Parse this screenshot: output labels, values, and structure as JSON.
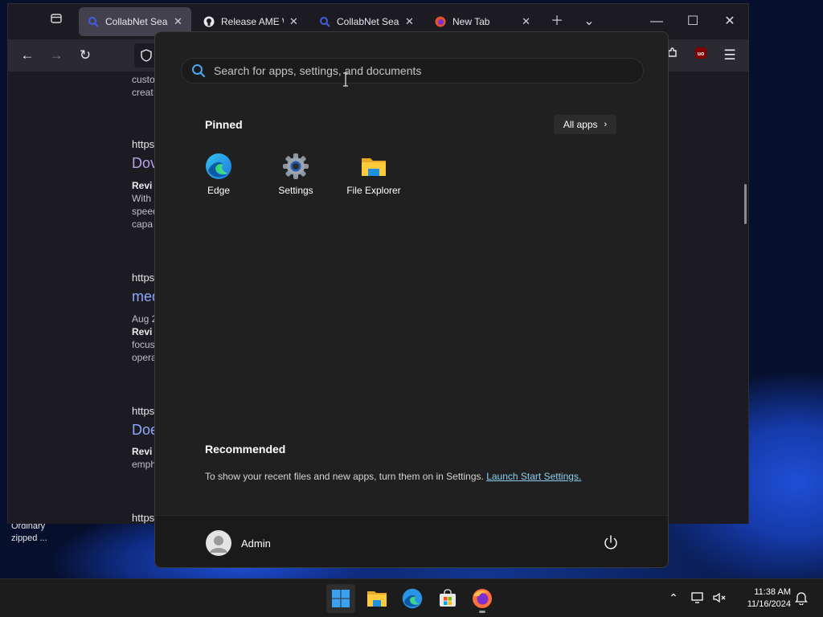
{
  "browser": {
    "tabs": [
      {
        "title": "CollabNet SearX",
        "active": true
      },
      {
        "title": "Release AME Wi",
        "active": false
      },
      {
        "title": "CollabNet SearX",
        "active": false
      },
      {
        "title": "New Tab",
        "active": false
      }
    ],
    "results": [
      {
        "frag1": "custo",
        "frag2": "creat"
      },
      {
        "url": "https",
        "title": "Dov",
        "bold": "Revi",
        "l1": "With",
        "l2": "speed",
        "l3": "capa"
      },
      {
        "url": "https",
        "title": "med",
        "date": "Aug 2",
        "bold": "Revi",
        "l1": "focus",
        "l2": "opera"
      },
      {
        "url": "https",
        "title": "Doe",
        "bold": "Revi",
        "l1": "emph"
      },
      {
        "url": "https"
      }
    ]
  },
  "desktop": {
    "wall_text_1": "Ordinary",
    "wall_text_2": "zipped ..."
  },
  "startmenu": {
    "search_placeholder": "Search for apps, settings, and documents",
    "pinned_title": "Pinned",
    "all_apps_label": "All apps",
    "pinned_apps": [
      {
        "label": "Edge",
        "icon": "edge-icon"
      },
      {
        "label": "Settings",
        "icon": "settings-gear-icon"
      },
      {
        "label": "File Explorer",
        "icon": "folder-icon"
      }
    ],
    "recommended_title": "Recommended",
    "recommended_text": "To show your recent files and new apps, turn them on in Settings.",
    "recommended_link": "Launch Start Settings.",
    "user_name": "Admin"
  },
  "taskbar": {
    "time": "11:38 AM",
    "date": "11/16/2024"
  }
}
